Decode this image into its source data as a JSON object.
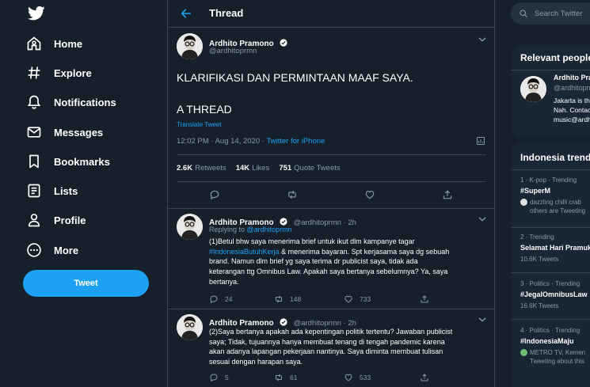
{
  "nav": {
    "items": [
      {
        "label": "Home",
        "icon": "home-icon"
      },
      {
        "label": "Explore",
        "icon": "hashtag-icon"
      },
      {
        "label": "Notifications",
        "icon": "bell-icon"
      },
      {
        "label": "Messages",
        "icon": "envelope-icon"
      },
      {
        "label": "Bookmarks",
        "icon": "bookmark-icon"
      },
      {
        "label": "Lists",
        "icon": "list-icon"
      },
      {
        "label": "Profile",
        "icon": "person-icon"
      },
      {
        "label": "More",
        "icon": "more-circle-icon"
      }
    ],
    "tweet_button": "Tweet"
  },
  "header": {
    "title": "Thread"
  },
  "main_tweet": {
    "name": "Ardhito Pramono",
    "handle": "@ardhitoprmn",
    "line1": "KLARIFIKASI DAN PERMINTAAN MAAF SAYA.",
    "line2": "A THREAD",
    "translate": "Translate Tweet",
    "time": "12:02 PM · Aug 14, 2020 · ",
    "source": "Twitter for iPhone",
    "retweets": "2.6K",
    "retweets_label": "Retweets",
    "likes": "14K",
    "likes_label": "Likes",
    "quotes": "751",
    "quotes_label": "Quote Tweets"
  },
  "replies": [
    {
      "name": "Ardhito Pramono",
      "meta": "@ardhitoprmn · 2h",
      "replying_prefix": "Replying to ",
      "replying_to": "@ardhitoprmn",
      "text_lines": [
        "(1)Betul bhw saya menerima brief untuk ikut dlm kampanye tagar",
        "& menerima bayaran. Spt kerjasama saya dg sebuah",
        "brand. Namun dlm brief yg saya terima dr publicist saya, tidak ada",
        "keterangan ttg Omnibus Law. Apakah saya bertanya sebelumnya? Ya, saya",
        "bertanya."
      ],
      "hashtag": "#IndonesiaButuhKerja",
      "replies_count": "24",
      "retweets_count": "148",
      "likes_count": "733"
    },
    {
      "name": "Ardhito Pramono",
      "meta": "@ardhitoprmn · 2h",
      "text_lines": [
        "(2)Saya bertanya apakah ada kepentingan politik tertentu? Jawaban publicist",
        "saya; Tidak, tujuannya hanya membuat tenang di tengah pandemic karena",
        "akan adanya lapangan pekerjaan nantinya. Saya diminta membuat tulisan",
        "sesuai dengan harapan saya."
      ],
      "replies_count": "5",
      "retweets_count": "61",
      "likes_count": "533"
    }
  ],
  "right": {
    "search_placeholder": "Search Twitter",
    "relevant_title": "Relevant people",
    "relevant_name": "Ardhito Pramono",
    "relevant_handle": "@ardhitoprmn",
    "relevant_bio": [
      "Jakarta is the",
      "Nah. Contact",
      "music@ardhito"
    ],
    "trends_title": "Indonesia trends",
    "trends": [
      {
        "meta": "1 · K-pop · Trending",
        "title": "#SuperM",
        "sub": [
          "dazzling chilli crab",
          "others are Tweeting"
        ]
      },
      {
        "meta": "2 · Trending",
        "title": "Selamat Hari Pramuka",
        "count": "10.6K Tweets"
      },
      {
        "meta": "3 · Politics · Trending",
        "title": "#JegalOmnibusLaw",
        "count": "16.6K Tweets"
      },
      {
        "meta": "4 · Politics · Trending",
        "title": "#IndonesiaMaju",
        "sub": [
          "METRO TV, Kemen",
          "Tweeting about this"
        ]
      }
    ]
  },
  "colors": {
    "background": "#15202b",
    "accent": "#1da1f2",
    "muted": "#8899a6",
    "border": "#38444d"
  }
}
